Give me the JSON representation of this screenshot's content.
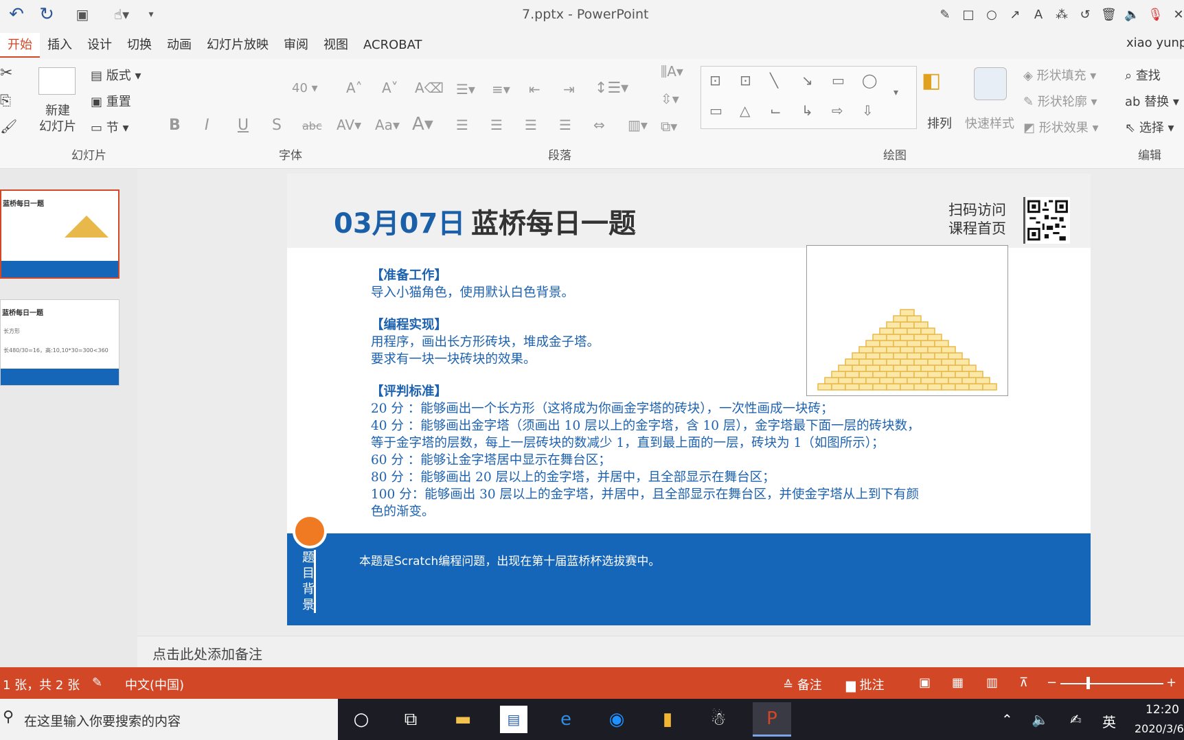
{
  "window": {
    "title": "7.pptx - PowerPoint",
    "user": "xiao yunp"
  },
  "ribbon_tabs": [
    "开始",
    "插入",
    "设计",
    "切换",
    "动画",
    "幻灯片放映",
    "审阅",
    "视图",
    "ACROBAT"
  ],
  "ribbon": {
    "new_slide": "新建\n幻灯片",
    "layout": "版式",
    "reset": "重置",
    "section": "节",
    "font_size": "40",
    "arrange": "排列",
    "quick_styles": "快速样式",
    "shape_fill": "形状填充",
    "shape_outline": "形状轮廓",
    "shape_effects": "形状效果",
    "find": "查找",
    "replace": "替换",
    "select": "选择",
    "groups": {
      "slides": "幻灯片",
      "font": "字体",
      "paragraph": "段落",
      "drawing": "绘图",
      "editing": "编辑"
    }
  },
  "thumbnails": [
    {
      "title": "蓝桥每日一题"
    },
    {
      "title": "蓝桥每日一题",
      "line1": "长方形",
      "line2": "长480/30=16，高:10,10*30=300<360"
    }
  ],
  "slide": {
    "date": "03月07日",
    "headline": "蓝桥每日一题",
    "qr_label_1": "扫码访问",
    "qr_label_2": "课程首页",
    "prep_title": "【准备工作】",
    "prep_text": "导入小猫角色，使用默认白色背景。",
    "impl_title": "【编程实现】",
    "impl_text_1": "用程序，画出长方形砖块，堆成金子塔。",
    "impl_text_2": "要求有一块一块砖块的效果。",
    "criteria_title": "【评判标准】",
    "criteria_1": "20 分 ：能够画出一个长方形（这将成为你画金字塔的砖块），一次性画成一块砖；",
    "criteria_2": "40 分 ：能够画出金字塔（须画出 10 层以上的金字塔，含 10 层），金字塔最下面一层的砖块数，",
    "criteria_3": "等于金字塔的层数，每上一层砖块的数减少 1，直到最上面的一层，砖块为 1（如图所示）；",
    "criteria_4": "60 分 ：能够让金字塔居中显示在舞台区；",
    "criteria_5": "80 分 ：能够画出 20 层以上的金字塔，并居中，且全部显示在舞台区；",
    "criteria_6": "100 分：能够画出 30 层以上的金字塔，并居中，且全部显示在舞台区，并使金字塔从上到下有颜",
    "criteria_7": "色的渐变。",
    "background_label": "题目背景",
    "background_note": "本题是Scratch编程问题，出现在第十届蓝桥杯选拔赛中。"
  },
  "notes_placeholder": "点击此处添加备注",
  "statusbar": {
    "slide_count": "1 张，共 2 张",
    "language": "中文(中国)",
    "notes": "备注",
    "comments": "批注"
  },
  "taskbar": {
    "search_placeholder": "在这里输入你要搜索的内容",
    "ime": "英",
    "time": "12:20",
    "date": "2020/3/6"
  },
  "colors": {
    "accent": "#d24726",
    "slide_blue": "#1565b8",
    "orange": "#f07a22",
    "gold": "#e8b84a"
  }
}
